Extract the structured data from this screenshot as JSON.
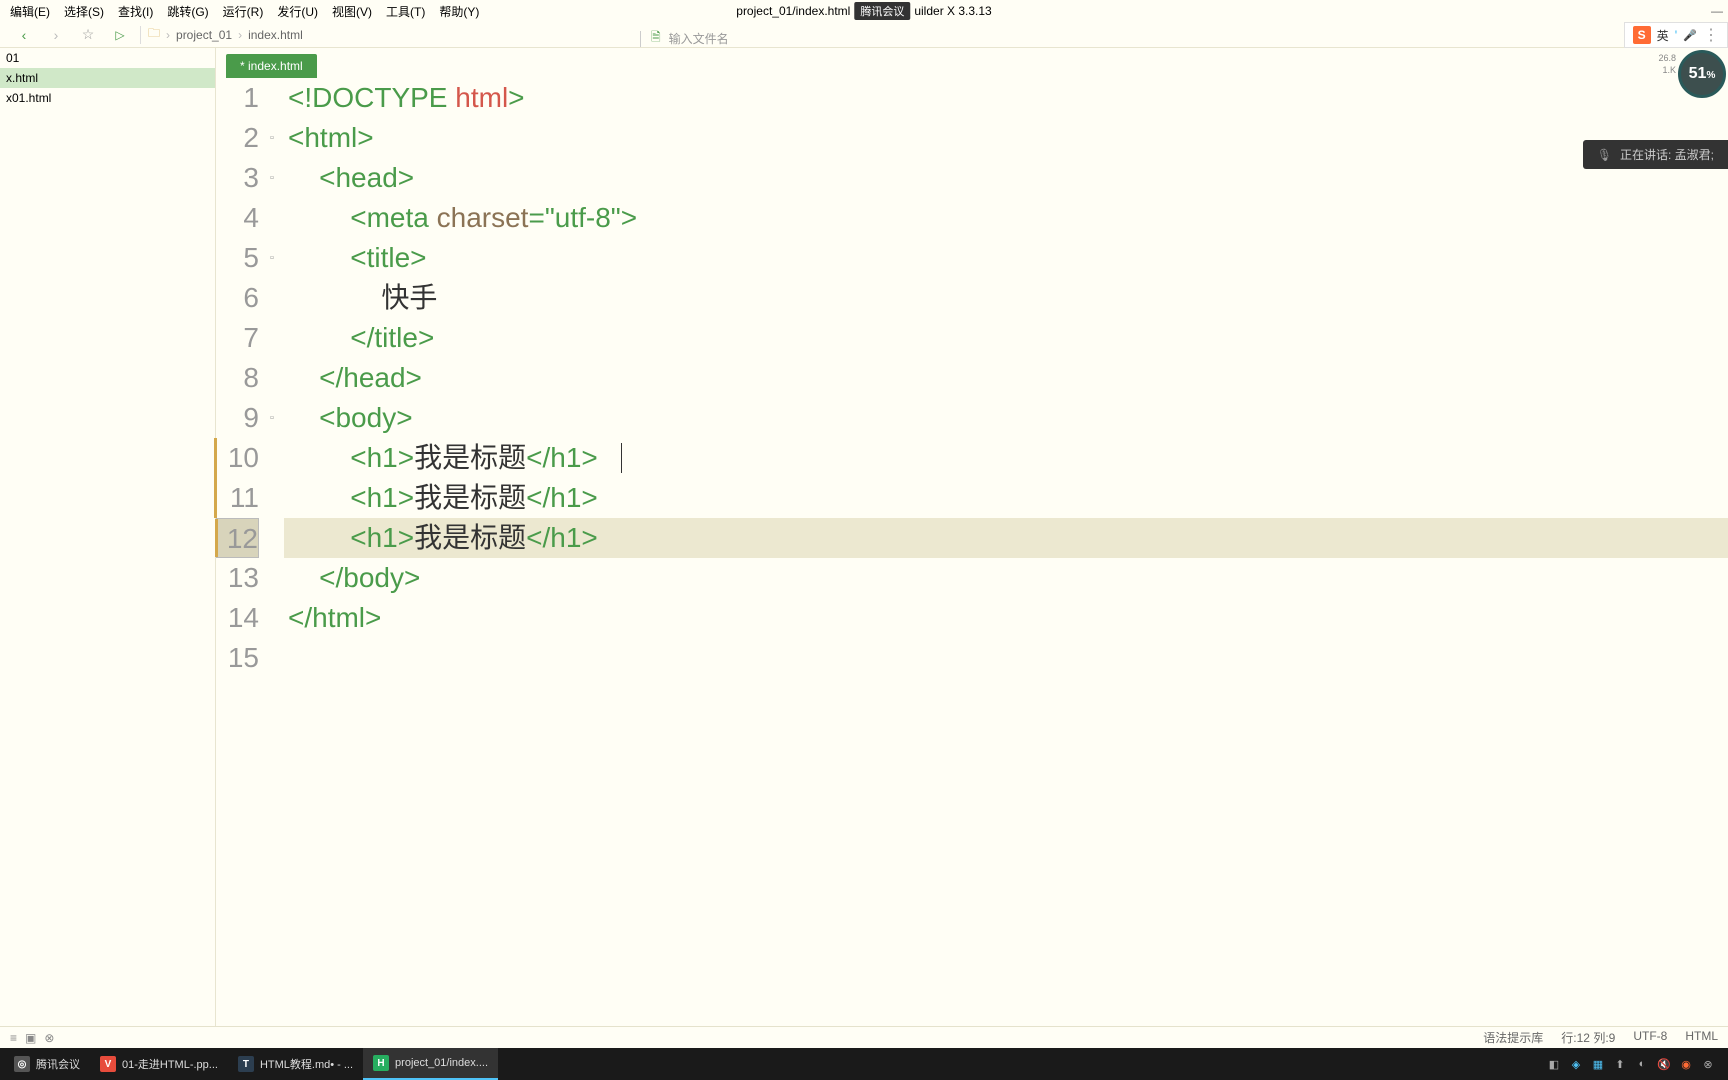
{
  "menu": {
    "items": [
      "编辑(E)",
      "选择(S)",
      "查找(I)",
      "跳转(G)",
      "运行(R)",
      "发行(U)",
      "视图(V)",
      "工具(T)",
      "帮助(Y)"
    ]
  },
  "title": {
    "text": "project_01/index.html",
    "overlay": "腾讯会议",
    "suffix": "uilder X 3.3.13"
  },
  "breadcrumb": {
    "parts": [
      "project_01",
      "index.html"
    ]
  },
  "search": {
    "placeholder": "输入文件名"
  },
  "ime": {
    "badge": "S",
    "lang": "英"
  },
  "sidebar": {
    "items": [
      {
        "label": "01",
        "active": false
      },
      {
        "label": "x.html",
        "active": true
      },
      {
        "label": "x01.html",
        "active": false
      }
    ]
  },
  "tabs": {
    "active": "* index.html"
  },
  "perf": {
    "value": "51",
    "unit": "%",
    "net1": "26.8",
    "net2": "1.K"
  },
  "speaker": {
    "label": "正在讲话: 孟淑君;"
  },
  "code": {
    "lines": [
      {
        "n": "1",
        "fold": "",
        "mod": false,
        "hl": false,
        "segs": [
          {
            "c": "tag",
            "t": "<!DOCTYPE "
          },
          {
            "c": "kw",
            "t": "html"
          },
          {
            "c": "tag",
            "t": ">"
          }
        ]
      },
      {
        "n": "2",
        "fold": "▫",
        "mod": false,
        "hl": false,
        "curr": false,
        "segs": [
          {
            "c": "tag",
            "t": "<html>"
          }
        ]
      },
      {
        "n": "3",
        "fold": "▫",
        "mod": false,
        "hl": false,
        "segs": [
          {
            "c": "",
            "t": "    "
          },
          {
            "c": "tag",
            "t": "<head>"
          }
        ]
      },
      {
        "n": "4",
        "fold": "",
        "mod": false,
        "hl": false,
        "segs": [
          {
            "c": "",
            "t": "        "
          },
          {
            "c": "tag",
            "t": "<meta "
          },
          {
            "c": "attr",
            "t": "charset"
          },
          {
            "c": "tag",
            "t": "="
          },
          {
            "c": "str",
            "t": "\"utf-8\""
          },
          {
            "c": "tag",
            "t": ">"
          }
        ]
      },
      {
        "n": "5",
        "fold": "▫",
        "mod": false,
        "hl": false,
        "segs": [
          {
            "c": "",
            "t": "        "
          },
          {
            "c": "tag",
            "t": "<title>"
          }
        ]
      },
      {
        "n": "6",
        "fold": "",
        "mod": false,
        "hl": false,
        "segs": [
          {
            "c": "",
            "t": "            "
          },
          {
            "c": "txt",
            "t": "快手"
          }
        ]
      },
      {
        "n": "7",
        "fold": "",
        "mod": false,
        "hl": false,
        "segs": [
          {
            "c": "",
            "t": "        "
          },
          {
            "c": "tag",
            "t": "</title>"
          }
        ]
      },
      {
        "n": "8",
        "fold": "",
        "mod": false,
        "hl": false,
        "segs": [
          {
            "c": "",
            "t": "    "
          },
          {
            "c": "tag",
            "t": "</head>"
          }
        ]
      },
      {
        "n": "9",
        "fold": "▫",
        "mod": false,
        "hl": false,
        "segs": [
          {
            "c": "",
            "t": "    "
          },
          {
            "c": "tag",
            "t": "<body>"
          }
        ]
      },
      {
        "n": "10",
        "fold": "",
        "mod": true,
        "hl": false,
        "segs": [
          {
            "c": "",
            "t": "        "
          },
          {
            "c": "tag",
            "t": "<h1>"
          },
          {
            "c": "txt",
            "t": "我是标题"
          },
          {
            "c": "tag",
            "t": "</h1>"
          }
        ],
        "cursor": true
      },
      {
        "n": "11",
        "fold": "",
        "mod": true,
        "hl": false,
        "segs": [
          {
            "c": "",
            "t": "        "
          },
          {
            "c": "tag",
            "t": "<h1>"
          },
          {
            "c": "txt",
            "t": "我是标题"
          },
          {
            "c": "tag",
            "t": "</h1>"
          }
        ]
      },
      {
        "n": "12",
        "fold": "",
        "mod": true,
        "hl": true,
        "curr": true,
        "segs": [
          {
            "c": "",
            "t": "        "
          },
          {
            "c": "tag",
            "t": "<h1>"
          },
          {
            "c": "txt",
            "t": "我是标题"
          },
          {
            "c": "tag",
            "t": "</h1>"
          }
        ]
      },
      {
        "n": "13",
        "fold": "",
        "mod": false,
        "hl": false,
        "segs": [
          {
            "c": "",
            "t": "    "
          },
          {
            "c": "tag",
            "t": "</body>"
          }
        ]
      },
      {
        "n": "14",
        "fold": "",
        "mod": false,
        "hl": false,
        "segs": [
          {
            "c": "tag",
            "t": "</html>"
          }
        ]
      },
      {
        "n": "15",
        "fold": "",
        "mod": false,
        "hl": false,
        "segs": []
      }
    ]
  },
  "status": {
    "syntax": "语法提示库",
    "pos": "行:12 列:9",
    "enc": "UTF-8",
    "lang": "HTML"
  },
  "taskbar": {
    "items": [
      {
        "icon": "gray",
        "label": "腾讯会议"
      },
      {
        "icon": "red",
        "label": "01-走进HTML-.pp..."
      },
      {
        "icon": "blue",
        "label": "HTML教程.md• - ..."
      },
      {
        "icon": "green",
        "label": "project_01/index...."
      }
    ]
  }
}
